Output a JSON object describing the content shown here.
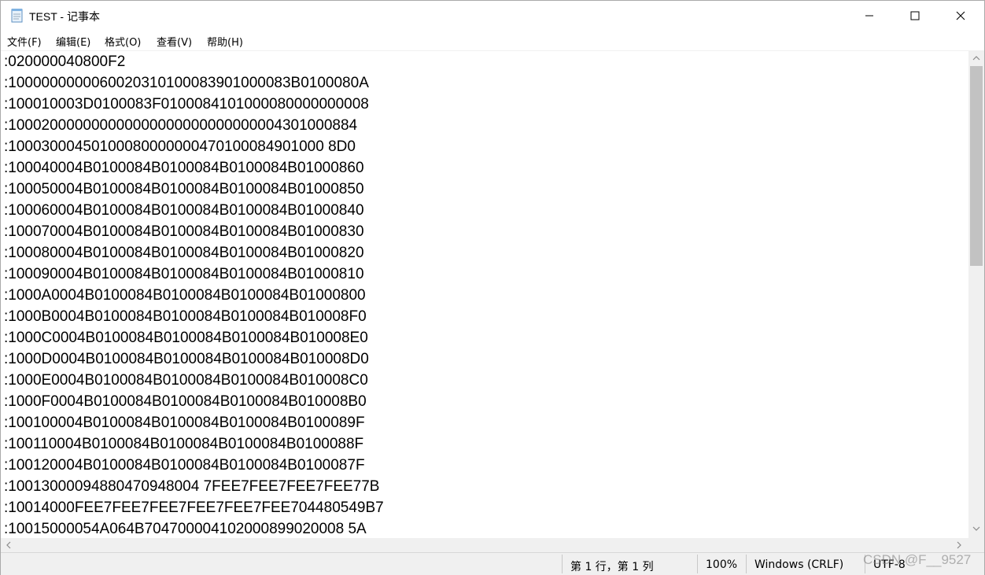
{
  "window": {
    "title": "TEST - 记事本",
    "controls": {
      "minimize_icon": "minimize-icon",
      "maximize_icon": "maximize-icon",
      "close_icon": "close-icon"
    }
  },
  "menu": {
    "items": [
      {
        "label": "文件(F)"
      },
      {
        "label": "编辑(E)"
      },
      {
        "label": "格式(O)"
      },
      {
        "label": "查看(V)"
      },
      {
        "label": "帮助(H)"
      }
    ]
  },
  "editor": {
    "lines": [
      ":020000040800F2",
      ":1000000000060020310100083901000083B0100080A",
      ":100010003D0100083F0100084101000080000000008",
      ":100020000000000000000000000000004301000884",
      ":10003000450100080000000470100084901000 8D0",
      ":100040004B0100084B0100084B0100084B01000860",
      ":100050004B0100084B0100084B0100084B01000850",
      ":100060004B0100084B0100084B0100084B01000840",
      ":100070004B0100084B0100084B0100084B01000830",
      ":100080004B0100084B0100084B0100084B01000820",
      ":100090004B0100084B0100084B0100084B01000810",
      ":1000A0004B0100084B0100084B0100084B01000800",
      ":1000B0004B0100084B0100084B0100084B010008F0",
      ":1000C0004B0100084B0100084B0100084B010008E0",
      ":1000D0004B0100084B0100084B0100084B010008D0",
      ":1000E0004B0100084B0100084B0100084B010008C0",
      ":1000F0004B0100084B0100084B0100084B010008B0",
      ":100100004B0100084B0100084B0100084B0100089F",
      ":100110004B0100084B0100084B0100084B0100088F",
      ":100120004B0100084B0100084B0100084B0100087F",
      ":10013000094880470948004 7FEE7FEE7FEE7FEE77B",
      ":10014000FEE7FEE7FEE7FEE7FEE7FEE704480549B7",
      ":10015000054A064B704700004102000899020008 5A"
    ]
  },
  "status": {
    "position": "第 1 行，第 1 列",
    "zoom": "100%",
    "line_ending": "Windows (CRLF)",
    "encoding": "UTF-8"
  },
  "watermark": "CSDN @F__9527"
}
